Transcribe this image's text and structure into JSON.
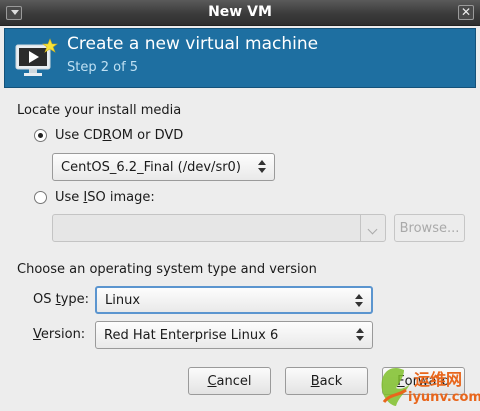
{
  "window": {
    "title": "New VM"
  },
  "header": {
    "title": "Create a new virtual machine",
    "step": "Step 2 of 5"
  },
  "install_media": {
    "section_label": "Locate your install media",
    "cdrom_option": {
      "pre": "Use CD",
      "mnemonic": "R",
      "post": "OM or DVD",
      "checked": true
    },
    "cdrom_device": "CentOS_6.2_Final (/dev/sr0)",
    "iso_option": {
      "pre": "Use ",
      "mnemonic": "I",
      "post": "SO image:",
      "checked": false
    },
    "iso_path": "",
    "browse_label": "Browse..."
  },
  "os": {
    "section_label": "Choose an operating system type and version",
    "type_label": {
      "pre": "OS ",
      "mnemonic": "t",
      "post": "ype:"
    },
    "type_value": "Linux",
    "version_label": {
      "pre": "",
      "mnemonic": "V",
      "post": "ersion:"
    },
    "version_value": "Red Hat Enterprise Linux 6"
  },
  "buttons": {
    "cancel": {
      "pre": "",
      "mnemonic": "C",
      "post": "ancel"
    },
    "back": {
      "pre": "",
      "mnemonic": "B",
      "post": "ack"
    },
    "forward": {
      "pre": "",
      "mnemonic": "F",
      "post": "orward"
    }
  },
  "watermark": {
    "line1": "运维网",
    "line2": "iyunv.com"
  },
  "colors": {
    "header_bg": "#1e6fa1",
    "watermark": "#e8661c"
  }
}
